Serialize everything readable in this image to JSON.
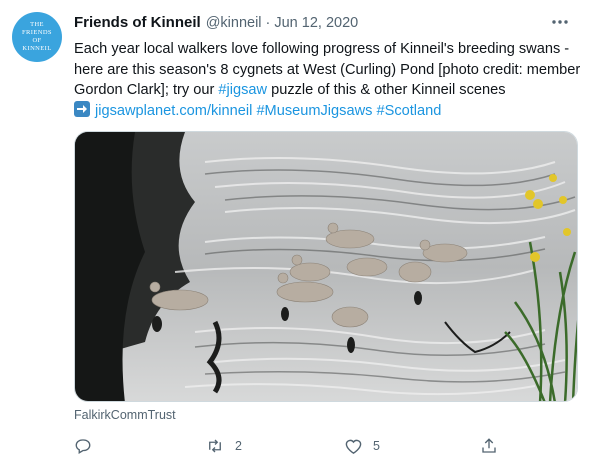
{
  "account": {
    "avatar_lines": [
      "THE",
      "FRIENDS",
      "OF",
      "KINNEIL"
    ],
    "avatar_color": "#3aa4de",
    "display_name": "Friends of Kinneil",
    "handle": "@kinneil",
    "separator": "·",
    "date": "Jun 12, 2020"
  },
  "tweet": {
    "text_main": "Each year local walkers love following progress of Kinneil's breeding swans - here are this season's 8 cygnets at West (Curling) Pond [photo credit: member Gordon Clark]; try our ",
    "hashtag_jigsaw": "#jigsaw",
    "text_after_hashtag": " puzzle of this & other Kinneil scenes",
    "arrow_emoji": "arrow-right-emoji",
    "link": "jigsawplanet.com/kinneil",
    "hashtag_museum": "#MuseumJigsaws",
    "hashtag_scotland": "#Scotland",
    "link_color": "#1b95e0"
  },
  "media": {
    "description_icon": "photo-of-cygnets-on-pond"
  },
  "source_label": "FalkirkCommTrust",
  "actions": {
    "reply_icon": "reply-icon",
    "retweet_icon": "retweet-icon",
    "retweet_count": "2",
    "like_icon": "heart-icon",
    "like_count": "5",
    "share_icon": "share-icon"
  },
  "colors": {
    "muted": "#536471",
    "text": "#0f1419"
  }
}
